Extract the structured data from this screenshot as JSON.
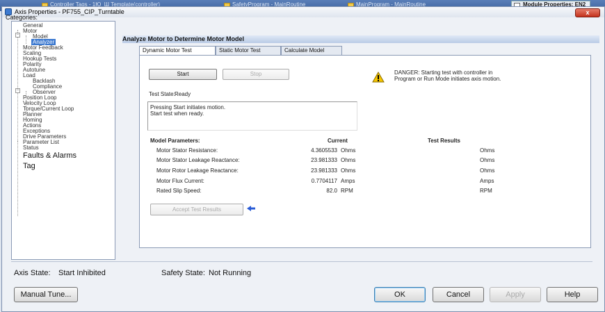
{
  "taskbar": {
    "tabs": [
      {
        "label": "Controller Tags - 1Ю_Ш Templatе(controller)"
      },
      {
        "label": "SafetyProgram - MainRoutine"
      },
      {
        "label": "MainProgram - MainRoutine"
      },
      {
        "label": "Module Properties: EN2"
      }
    ]
  },
  "window": {
    "title": "Axis Properties - PF755_CIP_Turntable",
    "close_label": "x"
  },
  "categories": {
    "label": "Categories:",
    "items": [
      "General",
      "Motor",
      "Model",
      "Analyzer",
      "Motor Feedback",
      "Scaling",
      "Hookup Tests",
      "Polarity",
      "Autotune",
      "Load",
      "Backlash",
      "Compliance",
      "Observer",
      "Position Loop",
      "Velocity Loop",
      "Torque/Current Loop",
      "Planner",
      "Homing",
      "Actions",
      "Exceptions",
      "Drive Parameters",
      "Parameter List",
      "Status",
      "Faults & Alarms",
      "Tag"
    ]
  },
  "section_title": "Analyze Motor to Determine Motor Model",
  "tabs": [
    "Dynamic Motor Test",
    "Static Motor Test",
    "Calculate Model"
  ],
  "panel": {
    "start_label": "Start",
    "stop_label": "Stop",
    "danger_text_1": "DANGER: Starting test with controller in",
    "danger_text_2": "Program or Run Mode initiates axis motion.",
    "test_state_label": "Test State:",
    "test_state_value": "Ready",
    "message_line_1": "Pressing Start initiates motion.",
    "message_line_2": "Start test when ready.",
    "headers": {
      "params": "Model Parameters:",
      "current": "Current",
      "results": "Test Results"
    },
    "rows": [
      {
        "name": "Motor Stator Resistance:",
        "current": "4.3605533",
        "unit": "Ohms",
        "result_unit": "Ohms"
      },
      {
        "name": "Motor Stator Leakage Reactance:",
        "current": "23.981333",
        "unit": "Ohms",
        "result_unit": "Ohms"
      },
      {
        "name": "Motor Rotor Leakage Reactance:",
        "current": "23.981333",
        "unit": "Ohms",
        "result_unit": "Ohms"
      },
      {
        "name": "Motor Flux Current:",
        "current": "0.7704117",
        "unit": "Amps",
        "result_unit": "Amps"
      },
      {
        "name": "Rated Slip Speed:",
        "current": "82.0",
        "unit": "RPM",
        "result_unit": "RPM"
      }
    ],
    "accept_label": "Accept Test Results"
  },
  "status": {
    "axis_state_label": "Axis State:",
    "axis_state_value": "Start Inhibited",
    "safety_state_label": "Safety State:",
    "safety_state_value": "Not Running"
  },
  "buttons": {
    "manual_tune": "Manual Tune...",
    "ok": "OK",
    "cancel": "Cancel",
    "apply": "Apply",
    "help": "Help"
  }
}
